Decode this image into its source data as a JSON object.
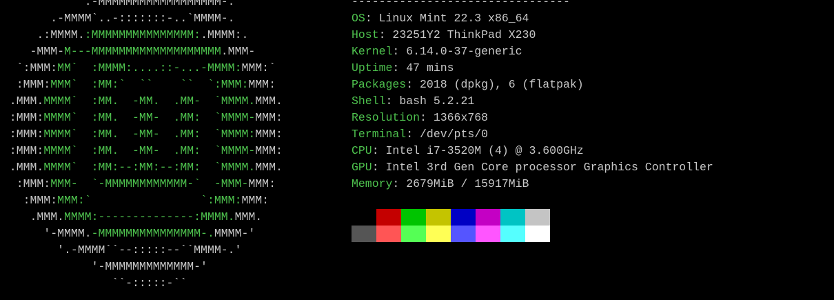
{
  "logo": {
    "colors": {
      "white": "#c8c8c8",
      "green": "#4ec24e"
    },
    "lines": [
      [
        [
          "w",
          "             .-MMMMMMMMMMMMMMMMMM-."
        ]
      ],
      [
        [
          "w",
          "        .-MMMM`..-:::::::-..`MMMM-."
        ]
      ],
      [
        [
          "w",
          "      .:MMMM."
        ],
        [
          "g",
          ":MMMMMMMMMMMMMMM:"
        ],
        [
          "w",
          ".MMMM:."
        ]
      ],
      [
        [
          "w",
          "     -MMM-"
        ],
        [
          "g",
          "M---MMMMMMMMMMMMMMMMMMM"
        ],
        [
          "w",
          ".MMM-"
        ]
      ],
      [
        [
          "w",
          "   `:MMM:"
        ],
        [
          "g",
          "MM`  :MMMM:....::-...-MMMM:"
        ],
        [
          "w",
          "MMM:`"
        ]
      ],
      [
        [
          "w",
          "   :MMM:"
        ],
        [
          "g",
          "MMM`  :MM:`  ``    ``  `:MMM:"
        ],
        [
          "w",
          "MMM:"
        ]
      ],
      [
        [
          "w",
          "  .MMM."
        ],
        [
          "g",
          "MMMM`  :MM.  -MM.  .MM-  `MMMM."
        ],
        [
          "w",
          "MMM."
        ]
      ],
      [
        [
          "w",
          "  :MMM:"
        ],
        [
          "g",
          "MMMM`  :MM.  -MM-  .MM:  `MMMM-"
        ],
        [
          "w",
          "MMM:"
        ]
      ],
      [
        [
          "w",
          "  :MMM:"
        ],
        [
          "g",
          "MMMM`  :MM.  -MM-  .MM:  `MMMM:"
        ],
        [
          "w",
          "MMM:"
        ]
      ],
      [
        [
          "w",
          "  :MMM:"
        ],
        [
          "g",
          "MMMM`  :MM.  -MM-  .MM:  `MMMM-"
        ],
        [
          "w",
          "MMM:"
        ]
      ],
      [
        [
          "w",
          "  .MMM."
        ],
        [
          "g",
          "MMMM`  :MM:--:MM:--:MM:  `MMMM."
        ],
        [
          "w",
          "MMM."
        ]
      ],
      [
        [
          "w",
          "   :MMM:"
        ],
        [
          "g",
          "MMM-  `-MMMMMMMMMMMM-`  -MMM-"
        ],
        [
          "w",
          "MMM:"
        ]
      ],
      [
        [
          "w",
          "    :MMM:"
        ],
        [
          "g",
          "MMM:`                `:MMM:"
        ],
        [
          "w",
          "MMM:"
        ]
      ],
      [
        [
          "w",
          "     .MMM."
        ],
        [
          "g",
          "MMMM:--------------:MMMM."
        ],
        [
          "w",
          "MMM."
        ]
      ],
      [
        [
          "w",
          "       '-MMMM."
        ],
        [
          "g",
          "-MMMMMMMMMMMMMMM-."
        ],
        [
          "w",
          "MMMM-'"
        ]
      ],
      [
        [
          "w",
          "         '.-MMMM``--:::::--``MMMM-.'"
        ]
      ],
      [
        [
          "w",
          "              '-MMMMMMMMMMMMM-'"
        ]
      ],
      [
        [
          "w",
          "                 ``-:::::-``"
        ]
      ]
    ]
  },
  "info": {
    "separator": "--------------------------------",
    "rows": [
      {
        "key": "OS",
        "value": "Linux Mint 22.3 x86_64"
      },
      {
        "key": "Host",
        "value": "23251Y2 ThinkPad X230"
      },
      {
        "key": "Kernel",
        "value": "6.14.0-37-generic"
      },
      {
        "key": "Uptime",
        "value": "47 mins"
      },
      {
        "key": "Packages",
        "value": "2018 (dpkg), 6 (flatpak)"
      },
      {
        "key": "Shell",
        "value": "bash 5.2.21"
      },
      {
        "key": "Resolution",
        "value": "1366x768"
      },
      {
        "key": "Terminal",
        "value": "/dev/pts/0"
      },
      {
        "key": "CPU",
        "value": "Intel i7-3520M (4) @ 3.600GHz"
      },
      {
        "key": "GPU",
        "value": "Intel 3rd Gen Core processor Graphics Controller"
      },
      {
        "key": "Memory",
        "value": "2679MiB / 15917MiB"
      }
    ]
  },
  "palette": {
    "normal": [
      "#000000",
      "#c40000",
      "#00c400",
      "#c4c400",
      "#0000c4",
      "#c400c4",
      "#00c4c4",
      "#c4c4c4"
    ],
    "bright": [
      "#555555",
      "#ff5555",
      "#55ff55",
      "#ffff55",
      "#5555ff",
      "#ff55ff",
      "#55ffff",
      "#ffffff"
    ]
  }
}
